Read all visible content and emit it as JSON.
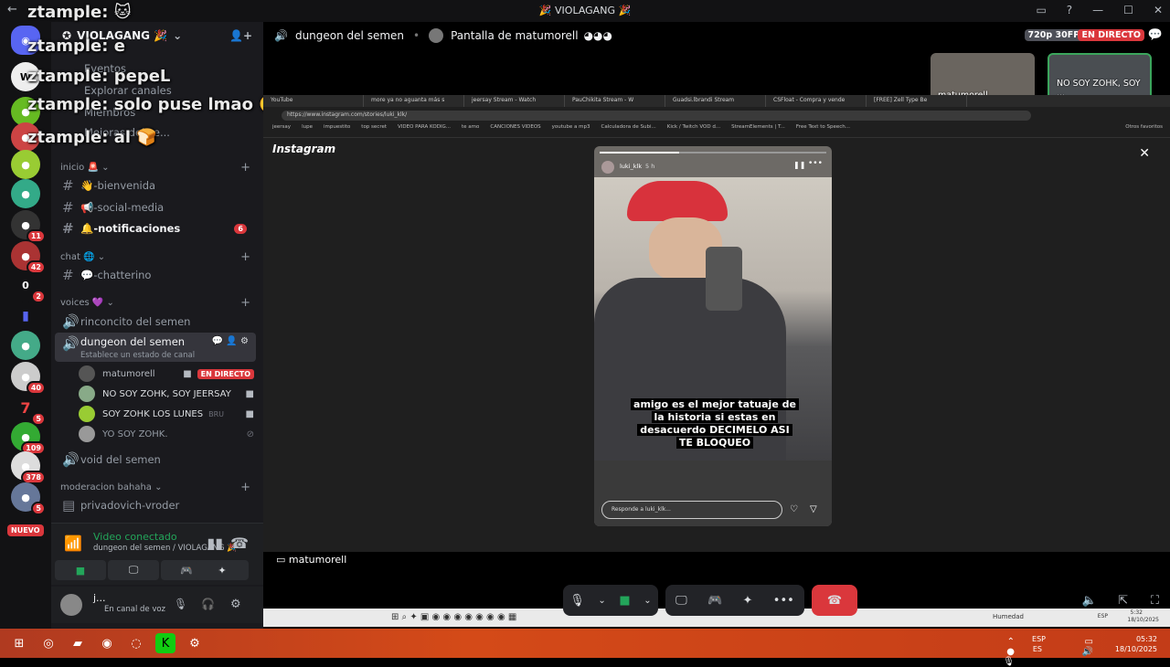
{
  "window": {
    "title": "🎉 VIOLAGANG 🎉"
  },
  "overlay_chat": [
    {
      "name": "ztample:",
      "msg": ""
    },
    {
      "name": "ztample:",
      "msg": "e"
    },
    {
      "name": "ztample:",
      "msg": "pepeL"
    },
    {
      "name": "ztample:",
      "msg": "solo puse lmao"
    },
    {
      "name": "ztample:",
      "msg": "al"
    }
  ],
  "server_badges": [
    "11",
    "42",
    "0",
    "2",
    "40",
    "5",
    "109",
    "378",
    "5"
  ],
  "nuevo_label": "NUEVO",
  "guild": {
    "name": "VIOLAGANG 🎉"
  },
  "menu_ghost": [
    "Eventos",
    "Explorar canales",
    "Miembros",
    "Mejoras del se..."
  ],
  "categories": {
    "inicio": "inicio 🚨",
    "chat": "chat 🌐",
    "voices": "voices 💜",
    "moderacion": "moderacion bahaha"
  },
  "channels": {
    "bienvenida": "👋-bienvenida",
    "social": "📢-social-media",
    "notificaciones": "🔔-notificaciones",
    "notif_count": "6",
    "chatterino": "💬-chatterino",
    "rinconcito": "rinconcito del semen",
    "dungeon": "dungeon del semen",
    "dungeon_status": "Establece un estado de canal",
    "void": "void del semen",
    "privadovich": "privadovich-vroder"
  },
  "voice_users": [
    {
      "name": "matumorell",
      "live": "EN DIRECTO"
    },
    {
      "name": "NO SOY ZOHK, SOY JEERSAY"
    },
    {
      "name": "SOY ZOHK LOS LUNES",
      "extra": "BRU"
    },
    {
      "name": "YO SOY ZOHK."
    }
  ],
  "voice_panel": {
    "status": "Video conectado",
    "sub": "dungeon del semen / VIOLAGANG 🎉"
  },
  "user_panel": {
    "name": "j...",
    "status": "En canal de voz"
  },
  "topbar": {
    "channel": "dungeon del semen",
    "screen": "Pantalla de matumorell",
    "quality": "720p 30FPS",
    "live": "EN DIRECTO"
  },
  "thumbs": [
    {
      "label": "matumorell"
    },
    {
      "label": "NO SOY ZOHK, SOY ..."
    }
  ],
  "browser": {
    "tabs": [
      "YouTube",
      "more ya no aguanta más s",
      "jeersay Stream - Watch",
      "PauChikita Stream - W",
      "Guadsi.lbrandi Stream",
      "CSFloat - Compra y vende",
      "[FREE] Zell Type Be"
    ],
    "url": "https://www.instagram.com/stories/luki_klk/",
    "bookmarks": [
      "jeersay",
      "lupe",
      "impuestito",
      "top secret",
      "VIDEO PARA KODIG...",
      "te amo",
      "CANCIONES VIDEOS",
      "youtube a mp3",
      "Calculadora de Subi...",
      "Kick / Twitch VOD d...",
      "StreamElements | T...",
      "Free Text to Speech...",
      "Otros favoritos"
    ],
    "logo": "Instagram",
    "story_user": "luki_klk",
    "story_time": "5 h",
    "caption": [
      "amigo es el mejor tatuaje de",
      "la historia si estas en",
      "desacuerdo DECIMELO ASI",
      "TE BLOQUEO"
    ],
    "reply_placeholder": "Responde a luki_klk...",
    "stream_owner": "matumorell",
    "inner_tray": {
      "weather": "Humedad",
      "lang": "ESP",
      "time": "5:32",
      "date": "18/10/2025"
    }
  },
  "taskbar": {
    "lang1": "ESP",
    "lang2": "ES",
    "time": "05:32",
    "date": "18/10/2025"
  }
}
